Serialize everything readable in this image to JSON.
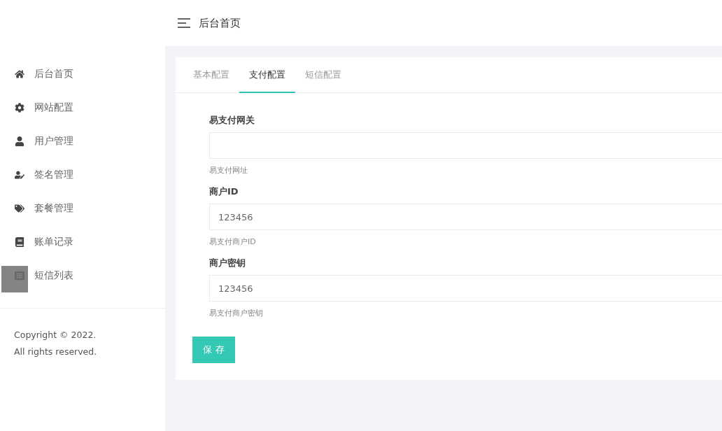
{
  "header": {
    "title": "后台首页"
  },
  "sidebar": {
    "items": [
      {
        "label": "后台首页",
        "selected": false
      },
      {
        "label": "网站配置",
        "selected": false
      },
      {
        "label": "用户管理",
        "selected": false
      },
      {
        "label": "签名管理",
        "selected": false
      },
      {
        "label": "套餐管理",
        "selected": false
      },
      {
        "label": "账单记录",
        "selected": false
      },
      {
        "label": "短信列表",
        "selected": false
      }
    ],
    "footer": [
      "Copyright © 2022.",
      "All rights reserved."
    ]
  },
  "tabs": [
    {
      "label": "基本配置",
      "selected": false
    },
    {
      "label": "支付配置",
      "selected": true
    },
    {
      "label": "短信配置",
      "selected": false
    }
  ],
  "fields": [
    {
      "label": "易支付网关",
      "help": "易支付网址"
    },
    {
      "label": "商户ID",
      "value": "123456",
      "help": "易支付商户ID"
    },
    {
      "label": "商户密钥",
      "value": "123456",
      "help": "易支付商户密钥"
    }
  ],
  "save_button": "保 存"
}
